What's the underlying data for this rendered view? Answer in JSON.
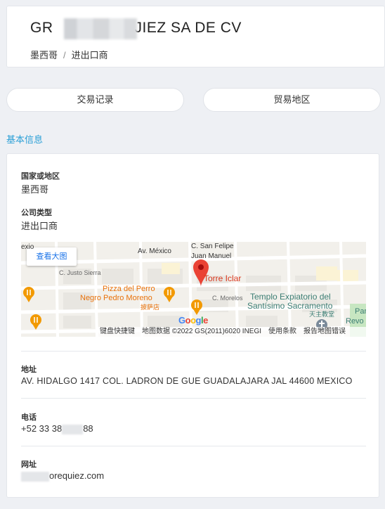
{
  "header": {
    "company_prefix": "GR",
    "company_suffix": "JIEZ SA DE CV",
    "breadcrumb_country": "墨西哥",
    "breadcrumb_separator": "/",
    "breadcrumb_type": "进出口商"
  },
  "tabs": {
    "trade_records": "交易记录",
    "trade_regions": "贸易地区"
  },
  "section": {
    "title": "基本信息"
  },
  "info": {
    "country_label": "国家或地区",
    "country_value": "墨西哥",
    "type_label": "公司类型",
    "type_value": "进出口商",
    "address_label": "地址",
    "address_value": "AV. HIDALGO 1417 COL. LADRON DE GUE GUADALAJARA JAL 44600 MEXICO",
    "phone_label": "电话",
    "phone_prefix": "+52 33 38",
    "phone_suffix": "88",
    "website_label": "网址",
    "website_suffix": "orequiez.com"
  },
  "map": {
    "view_larger": "查看大图",
    "labels": {
      "av_mexico": "Av. México",
      "c_san_felipe": "C. San Felipe",
      "juan_manuel": "Juan Manuel",
      "c_justo_sierra": "C. Justo Sierra",
      "pizza_line1": "Pizza del Perro",
      "pizza_line2": "Negro Pedro Moreno",
      "pizza_cn": "披萨店",
      "torre": "Torre Iclar",
      "c_morelos": "C. Morelos",
      "templo_line1": "Templo Expiatorio del",
      "templo_line2": "Santísimo Sacramento",
      "templo_cn": "天主教堂",
      "par": "Par",
      "revo": "Revo",
      "exio": "exio"
    },
    "footer": {
      "shortcuts": "键盘快捷键",
      "copyright": "地图数据 ©2022 GS(2011)6020 INEGI",
      "terms": "使用条款",
      "report": "报告地图错误"
    },
    "google": "Google"
  }
}
